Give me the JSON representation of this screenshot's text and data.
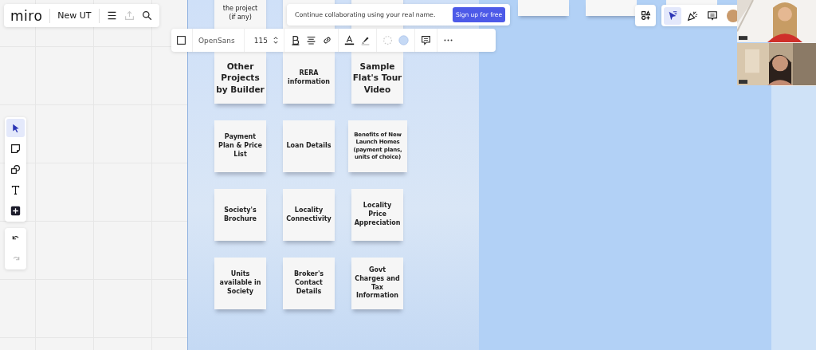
{
  "header": {
    "logo": "miro",
    "board_name": "New UT",
    "tools": [
      {
        "kind": "menu",
        "disabled": false
      },
      {
        "kind": "upload",
        "disabled": true
      },
      {
        "kind": "search",
        "disabled": false
      }
    ]
  },
  "banner": {
    "message": "Continue collaborating using your real name.",
    "button": "Sign up for free"
  },
  "format_toolbar": {
    "font": "OpenSans",
    "font_size": "115"
  },
  "left_toolbar": {
    "tools": [
      {
        "kind": "select",
        "selected": true
      },
      {
        "kind": "sticky",
        "selected": false
      },
      {
        "kind": "shapes",
        "selected": false
      },
      {
        "kind": "text",
        "selected": false
      },
      {
        "kind": "frame",
        "selected": false
      }
    ],
    "history": [
      {
        "kind": "undo",
        "disabled": false
      },
      {
        "kind": "redo",
        "disabled": true
      }
    ]
  },
  "right_toolbar": {
    "tools": [
      {
        "kind": "cursor",
        "selected": true
      },
      {
        "kind": "confetti",
        "selected": false
      },
      {
        "kind": "comment",
        "selected": false
      }
    ]
  },
  "sticky_notes": [
    {
      "kind": "cut",
      "text": "the project\n(if any)"
    },
    {
      "kind": "cut"
    },
    {
      "kind": "cut"
    },
    {
      "kind": "note",
      "text": "Other\nProjects\nby Builder"
    },
    {
      "kind": "note",
      "text": "RERA\ninformation"
    },
    {
      "kind": "note",
      "text": "Sample\nFlat's Tour\nVideo"
    },
    {
      "kind": "note",
      "text": "Payment\nPlan & Price\nList"
    },
    {
      "kind": "note",
      "text": "Loan Details"
    },
    {
      "kind": "note",
      "text": "Benefits of New\nLaunch Homes\n(payment plans,\nunits of choice)"
    },
    {
      "kind": "note",
      "text": "Society's\nBrochure"
    },
    {
      "kind": "note",
      "text": "Locality\nConnectivity"
    },
    {
      "kind": "note",
      "text": "Locality\nPrice\nAppreciation"
    },
    {
      "kind": "note",
      "text": "Units\navailable in\nSociety"
    },
    {
      "kind": "note",
      "text": "Broker's\nContact\nDetails"
    },
    {
      "kind": "note",
      "text": "Govt\nCharges and\nTax\nInformation"
    }
  ],
  "far_notes": [
    {
      "kind": "note"
    },
    {
      "kind": "note"
    },
    {
      "kind": "note"
    }
  ]
}
